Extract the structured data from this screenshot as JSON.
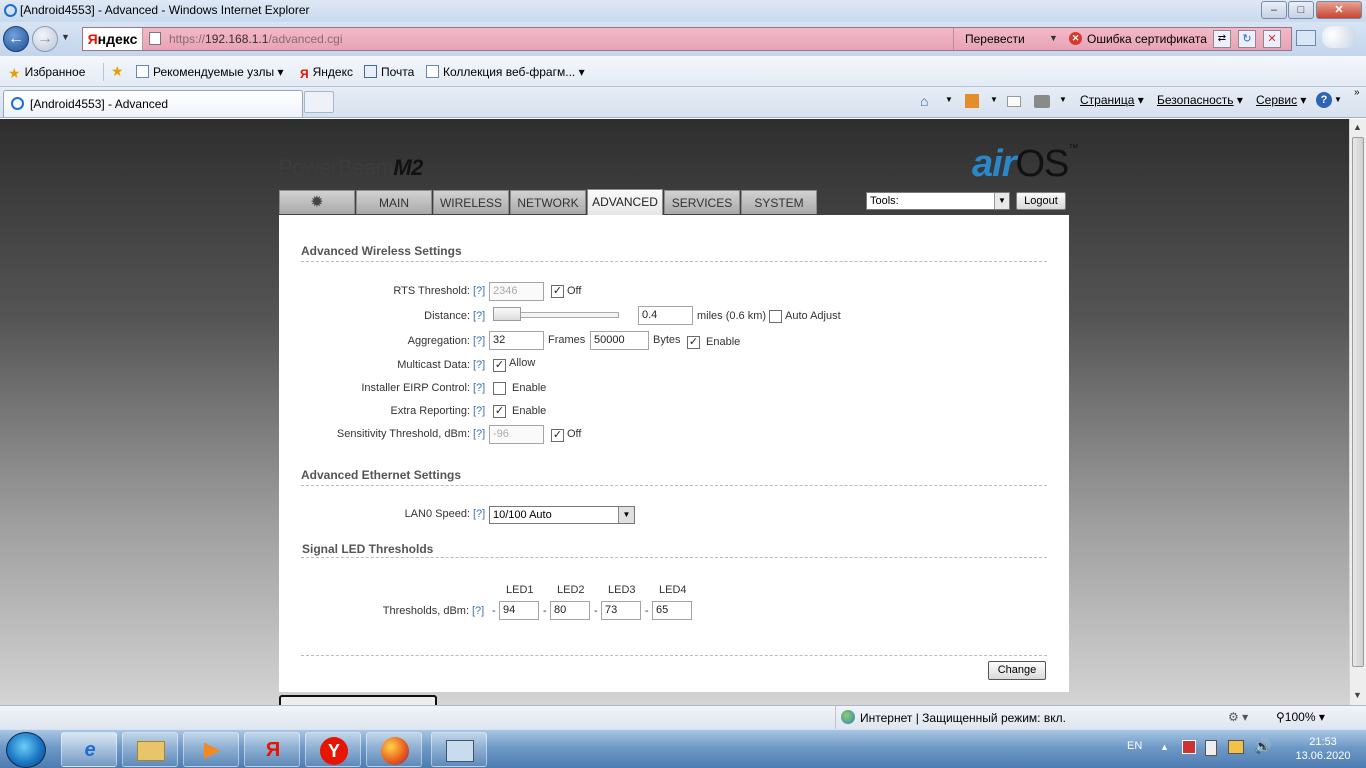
{
  "window": {
    "title": "[Android4553] - Advanced - Windows Internet Explorer",
    "minimize": "–",
    "maximize": "□",
    "close": "✕"
  },
  "address": {
    "search_brand_prefix": "Я",
    "search_brand_rest": "ндекс",
    "url_prefix": "https://",
    "url_host": "192.168.1.1",
    "url_path": "/advanced.cgi",
    "translate_label": "Перевести",
    "cert_error_label": "Ошибка сертификата"
  },
  "favorites": {
    "label": "Избранное",
    "items": [
      "Рекомендуемые узлы",
      "Яндекс",
      "Почта",
      "Коллекция веб-фрагм..."
    ]
  },
  "tabs": {
    "active_title": "[Android4553] - Advanced"
  },
  "commandbar": {
    "page": "Страница",
    "safety": "Безопасность",
    "service": "Сервис"
  },
  "airos": {
    "brand_main": "PowerBeam",
    "brand_model": "M2",
    "logo_air": "air",
    "logo_os": "OS",
    "logo_tm": "™",
    "nav_tabs": [
      "MAIN",
      "WIRELESS",
      "NETWORK",
      "ADVANCED",
      "SERVICES",
      "SYSTEM"
    ],
    "active_tab": "ADVANCED",
    "tools_placeholder": "Tools:",
    "logout_label": "Logout",
    "help_label": "[?]",
    "wireless": {
      "heading": "Advanced Wireless Settings",
      "rts_label": "RTS Threshold:",
      "rts_value": "2346",
      "rts_off_label": "Off",
      "distance_label": "Distance:",
      "distance_value": "0.4",
      "distance_units": "miles (0.6 km)",
      "auto_adjust_label": "Auto Adjust",
      "aggregation_label": "Aggregation:",
      "aggregation_frames": "32",
      "frames_label": "Frames",
      "aggregation_bytes": "50000",
      "bytes_label": "Bytes",
      "aggregation_enable_label": "Enable",
      "multicast_label": "Multicast Data:",
      "multicast_allow_label": "Allow",
      "eirp_label": "Installer EIRP Control:",
      "eirp_enable_label": "Enable",
      "extra_label": "Extra Reporting:",
      "extra_enable_label": "Enable",
      "sensitivity_label": "Sensitivity Threshold, dBm:",
      "sensitivity_value": "-96",
      "sensitivity_off_label": "Off"
    },
    "ethernet": {
      "heading": "Advanced Ethernet Settings",
      "lan_label": "LAN0 Speed:",
      "lan_value": "10/100 Auto"
    },
    "led": {
      "heading": "Signal LED Thresholds",
      "columns": [
        "LED1",
        "LED2",
        "LED3",
        "LED4"
      ],
      "thresholds_label": "Thresholds, dBm:",
      "minus": "-",
      "values": [
        "94",
        "80",
        "73",
        "65"
      ]
    },
    "change_label": "Change"
  },
  "statusbar": {
    "zone": "Интернет | Защищенный режим: вкл.",
    "zoom": "100%"
  },
  "taskbar": {
    "lang": "EN",
    "time": "21:53",
    "date": "13.06.2020",
    "yandex_glyph": "Я"
  }
}
